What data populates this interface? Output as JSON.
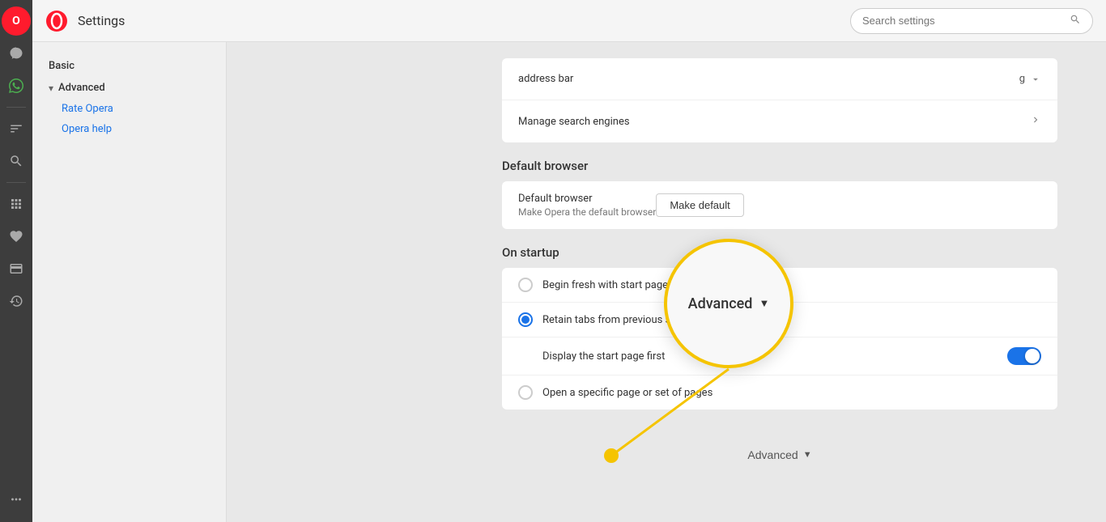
{
  "app": {
    "title": "Settings"
  },
  "search": {
    "placeholder": "Search settings"
  },
  "sidebar": {
    "basic_label": "Basic",
    "advanced_label": "Advanced",
    "links": [
      {
        "label": "Rate Opera",
        "id": "rate-opera"
      },
      {
        "label": "Opera help",
        "id": "opera-help"
      }
    ]
  },
  "icons": {
    "opera": "O",
    "messenger": "💬",
    "whatsapp": "📱",
    "feed": "📰",
    "search": "🔍",
    "extensions": "⊞",
    "bookmarks": "♡",
    "history": "🕐",
    "wallet": "💳",
    "more": "···"
  },
  "sections": {
    "address_bar": {
      "label": "address bar",
      "value": "g"
    },
    "manage_search": {
      "label": "Manage search engines"
    },
    "default_browser": {
      "section_title": "Default browser",
      "row_title": "Default browser",
      "row_subtitle": "Make Opera the default browser",
      "button_label": "Make default"
    },
    "on_startup": {
      "section_title": "On startup",
      "options": [
        {
          "id": "fresh",
          "label": "Begin fresh with start page",
          "checked": false
        },
        {
          "id": "retain",
          "label": "Retain tabs from previous session",
          "checked": true
        },
        {
          "id": "display",
          "label": "Display the start page first",
          "checked": null,
          "toggle": true
        },
        {
          "id": "specific",
          "label": "Open a specific page or set of pages",
          "checked": false
        }
      ]
    }
  },
  "bottom": {
    "advanced_label": "Advanced",
    "arrow": "▼"
  },
  "callout": {
    "text": "Advanced",
    "arrow": "▼"
  }
}
